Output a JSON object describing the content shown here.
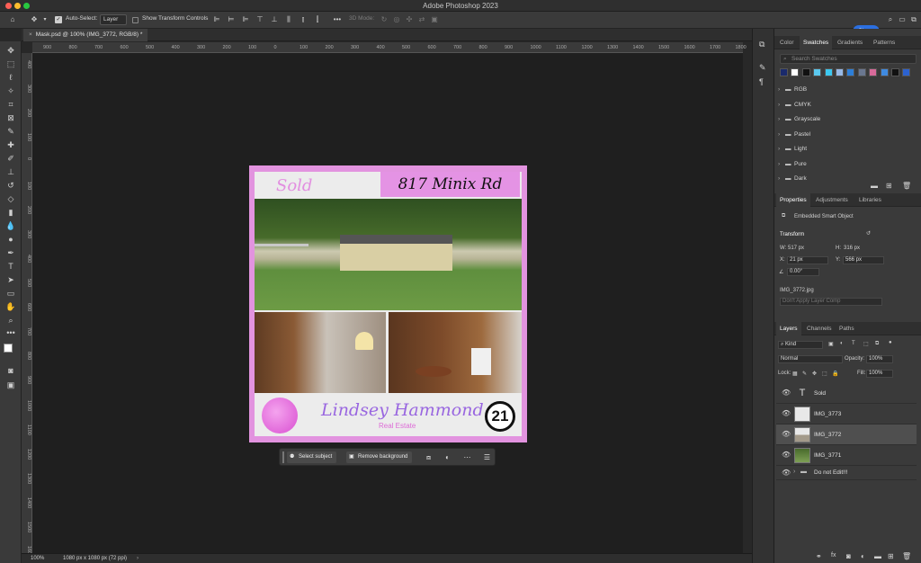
{
  "app_title": "Adobe Photoshop 2023",
  "options_bar": {
    "auto_select_label": "Auto-Select:",
    "auto_select_target": "Layer",
    "show_transform_label": "Show Transform Controls",
    "mode_3d_label": "3D Mode:",
    "share_label": "Share"
  },
  "document": {
    "tab_label": "Mask.psd @ 100% (IMG_3772, RGB/8) *"
  },
  "rulers": {
    "top": [
      "900",
      "800",
      "700",
      "600",
      "500",
      "400",
      "300",
      "200",
      "100",
      "0",
      "100",
      "200",
      "300",
      "400",
      "500",
      "600",
      "700",
      "800",
      "900",
      "1000",
      "1100",
      "1200",
      "1300",
      "1400",
      "1500",
      "1600",
      "1700",
      "1800",
      "190"
    ],
    "left": [
      "400",
      "300",
      "200",
      "100",
      "0",
      "100",
      "200",
      "300",
      "400",
      "500",
      "600",
      "700",
      "800",
      "900",
      "1000",
      "1100",
      "1200",
      "1300",
      "1400",
      "1500",
      "1600"
    ]
  },
  "flyer": {
    "sold": "Sold",
    "address": "817 Minix Rd",
    "agent_name": "Lindsey Hammond",
    "agent_subtitle": "Real Estate",
    "brand_mark": "21"
  },
  "context_bar": {
    "select_subject": "Select subject",
    "remove_background": "Remove background"
  },
  "status_bar": {
    "zoom": "100%",
    "doc_info": "1080 px x 1080 px (72 ppi)"
  },
  "swatches_panel": {
    "tabs": [
      "Color",
      "Swatches",
      "Gradients",
      "Patterns"
    ],
    "active_tab": "Swatches",
    "search_placeholder": "Search Swatches",
    "swatch_colors": [
      "#1a2a6c",
      "#ffffff",
      "#111111",
      "#5bc8ef",
      "#3cc8f0",
      "#98b9e6",
      "#2d7fd8",
      "#6a7790",
      "#d86a9a",
      "#3f8ae0",
      "#111111",
      "#2c62cf"
    ],
    "groups": [
      "RGB",
      "CMYK",
      "Grayscale",
      "Pastel",
      "Light",
      "Pure",
      "Dark"
    ]
  },
  "properties_panel": {
    "tabs": [
      "Properties",
      "Adjustments",
      "Libraries"
    ],
    "active_tab": "Properties",
    "object_type": "Embedded Smart Object",
    "section_transform": "Transform",
    "w_label": "W:",
    "w_value": "517 px",
    "h_label": "H:",
    "h_value": "316 px",
    "x_label": "X:",
    "x_value": "21 px",
    "y_label": "Y:",
    "y_value": "566 px",
    "angle_value": "0.00°",
    "linked_file": "IMG_3772.jpg",
    "layer_comp_placeholder": "Don't Apply Layer Comp"
  },
  "layers_panel": {
    "tabs": [
      "Layers",
      "Channels",
      "Paths"
    ],
    "active_tab": "Layers",
    "filter_kind": "Kind",
    "blend_mode": "Normal",
    "opacity_label": "Opacity:",
    "opacity_value": "100%",
    "lock_label": "Lock:",
    "fill_label": "Fill:",
    "fill_value": "100%",
    "layers": [
      {
        "name": "Sold",
        "kind": "text",
        "selected": false
      },
      {
        "name": "IMG_3773",
        "kind": "smart",
        "selected": false
      },
      {
        "name": "IMG_3772",
        "kind": "smart",
        "selected": true
      },
      {
        "name": "IMG_3771",
        "kind": "smart",
        "selected": false
      },
      {
        "name": "Do not Edit!!!",
        "kind": "group",
        "selected": false
      }
    ]
  }
}
